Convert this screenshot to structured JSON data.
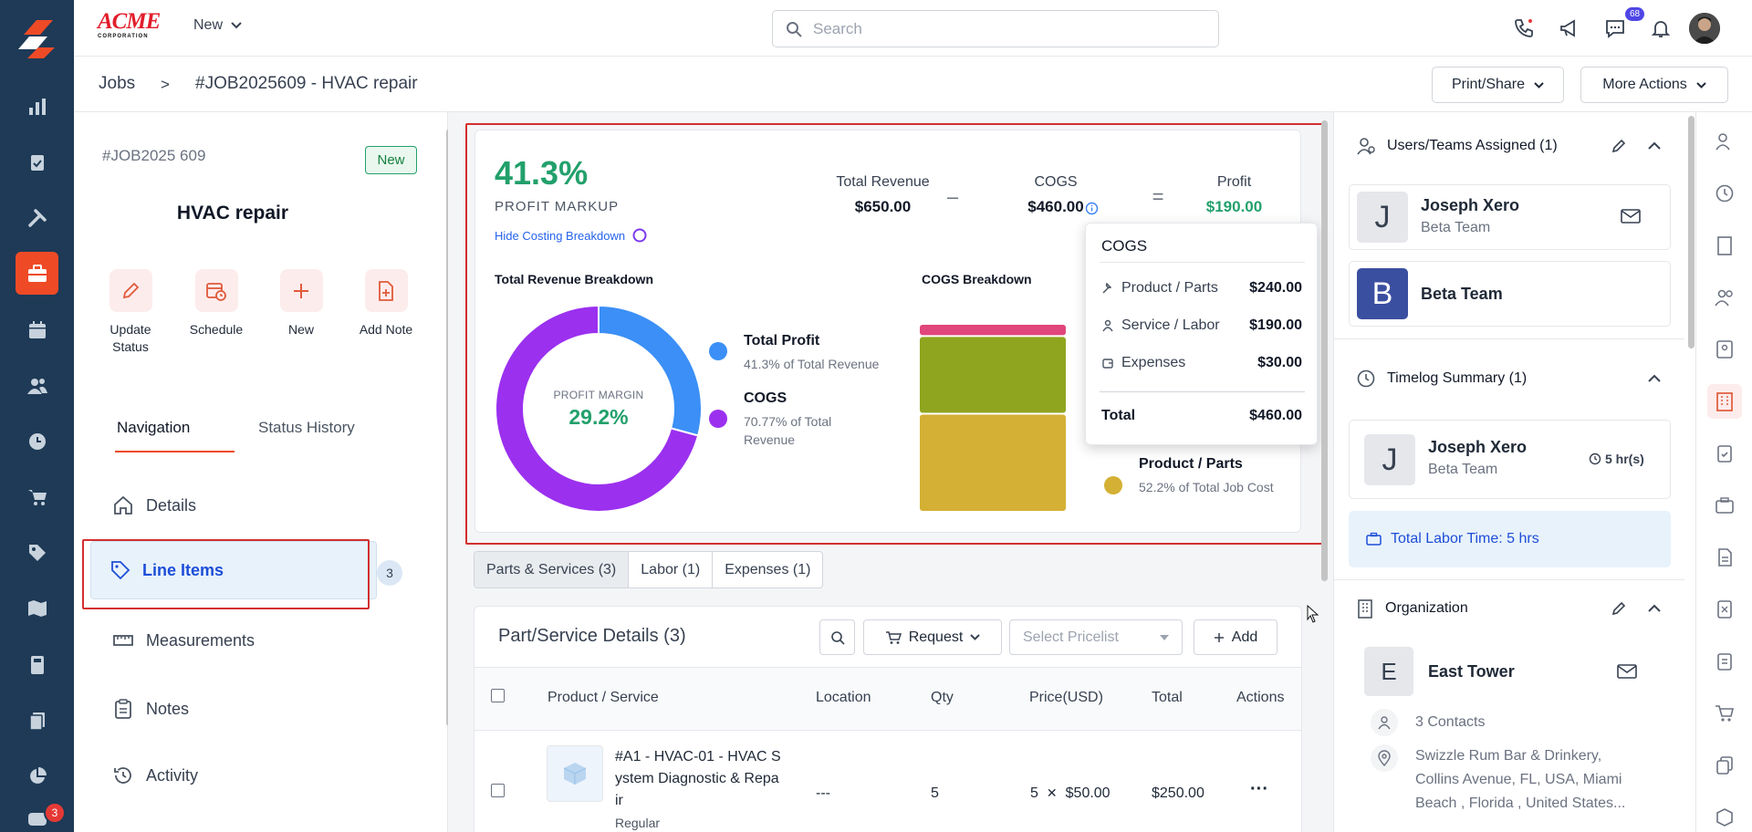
{
  "rail": {
    "chat_badge": "3"
  },
  "topbar": {
    "brand_line1": "ACME",
    "brand_line2": "CORPORATION",
    "new_label": "New",
    "search_placeholder": "Search",
    "notifications_count": "68"
  },
  "breadcrumb": {
    "root": "Jobs",
    "separator": ">",
    "current": "#JOB2025609 - HVAC repair"
  },
  "header_actions": {
    "print_share": "Print/Share",
    "more_actions": "More Actions"
  },
  "job": {
    "number": "#JOB2025 609",
    "status": "New",
    "title": "HVAC repair"
  },
  "quick_actions": [
    {
      "label": "Update Status",
      "icon": "pencil-icon"
    },
    {
      "label": "Schedule",
      "icon": "calendar-clock-icon"
    },
    {
      "label": "New",
      "icon": "plus-icon"
    },
    {
      "label": "Add Note",
      "icon": "file-plus-icon"
    }
  ],
  "nav_tabs": {
    "navigation": "Navigation",
    "status_history": "Status History"
  },
  "nav_items": {
    "details": "Details",
    "line_items": "Line Items",
    "line_items_count": "3",
    "measurements": "Measurements",
    "notes": "Notes",
    "activity": "Activity"
  },
  "costing": {
    "profit_markup_value": "41.3%",
    "profit_markup_label": "PROFIT MARKUP",
    "hide_link": "Hide Costing Breakdown",
    "total_revenue_label": "Total Revenue",
    "total_revenue_value": "$650.00",
    "minus": "–",
    "cogs_label": "COGS",
    "cogs_value": "$460.00",
    "equals": "=",
    "profit_label": "Profit",
    "profit_value": "$190.00",
    "revenue_breakdown_title": "Total Revenue Breakdown",
    "cogs_breakdown_title": "COGS Breakdown",
    "donut_center_label": "PROFIT MARGIN",
    "donut_center_value": "29.2%",
    "legend": [
      {
        "name": "Total Profit",
        "sub": "41.3% of Total Revenue",
        "color": "#3b8ff6"
      },
      {
        "name": "COGS",
        "sub": "70.77% of Total Revenue",
        "color": "#9b30ef"
      }
    ],
    "cogs_legend": {
      "name": "Product / Parts",
      "sub": "52.2% of Total Job Cost",
      "color": "#d4b034"
    }
  },
  "chart_data": [
    {
      "type": "pie",
      "title": "Total Revenue Breakdown",
      "categories": [
        "Total Profit",
        "COGS"
      ],
      "values": [
        29.2,
        70.8
      ],
      "colors": [
        "#3b8ff6",
        "#9b30ef"
      ]
    },
    {
      "type": "bar",
      "title": "COGS Breakdown",
      "stacked": true,
      "categories": [
        "Expenses",
        "Service / Labor",
        "Product / Parts"
      ],
      "values": [
        30,
        190,
        240
      ],
      "colors": [
        "#e0457b",
        "#8fa51f",
        "#d4b034"
      ]
    }
  ],
  "cogs_popover": {
    "title": "COGS",
    "rows": [
      {
        "label": "Product / Parts",
        "value": "$240.00",
        "icon": "wrench-icon"
      },
      {
        "label": "Service / Labor",
        "value": "$190.00",
        "icon": "person-icon"
      },
      {
        "label": "Expenses",
        "value": "$30.00",
        "icon": "wallet-icon"
      }
    ],
    "total_label": "Total",
    "total_value": "$460.00"
  },
  "detail_tabs": [
    "Parts & Services (3)",
    "Labor (1)",
    "Expenses (1)"
  ],
  "parts": {
    "title": "Part/Service Details (3)",
    "request_label": "Request",
    "pricelist_placeholder": "Select Pricelist",
    "add_label": "Add",
    "columns": [
      "Product / Service",
      "Location",
      "Qty",
      "Price(USD)",
      "Total",
      "Actions"
    ],
    "rows": [
      {
        "name": "#A1 - HVAC-01 - HVAC System Diagnostic & Repair",
        "name_lines": [
          "#A1 - HVAC-01 - HVAC S",
          "ystem Diagnostic & Repa",
          "ir"
        ],
        "tag": "Regular",
        "location": "---",
        "qty": "5",
        "price_qty": "5",
        "price_x": "✕",
        "price_unit": "$50.00",
        "total": "$250.00",
        "actions": "···"
      }
    ]
  },
  "right": {
    "users_title": "Users/Teams Assigned (1)",
    "user1_initial": "J",
    "user1_name": "Joseph Xero",
    "user1_team": "Beta Team",
    "team_initial": "B",
    "team_name": "Beta Team",
    "team_color": "#3b4fa0",
    "timelog_title": "Timelog Summary (1)",
    "timelog_initial": "J",
    "timelog_name": "Joseph Xero",
    "timelog_team": "Beta Team",
    "timelog_hours": "5 hr(s)",
    "total_labor": "Total Labor Time: 5 hrs",
    "org_title": "Organization",
    "org_initial": "E",
    "org_name": "East Tower",
    "contacts": "3 Contacts",
    "address_lines": [
      "Swizzle Rum Bar & Drinkery,",
      "Collins Avenue, FL, USA, Miami",
      "Beach , Florida , United States..."
    ]
  }
}
